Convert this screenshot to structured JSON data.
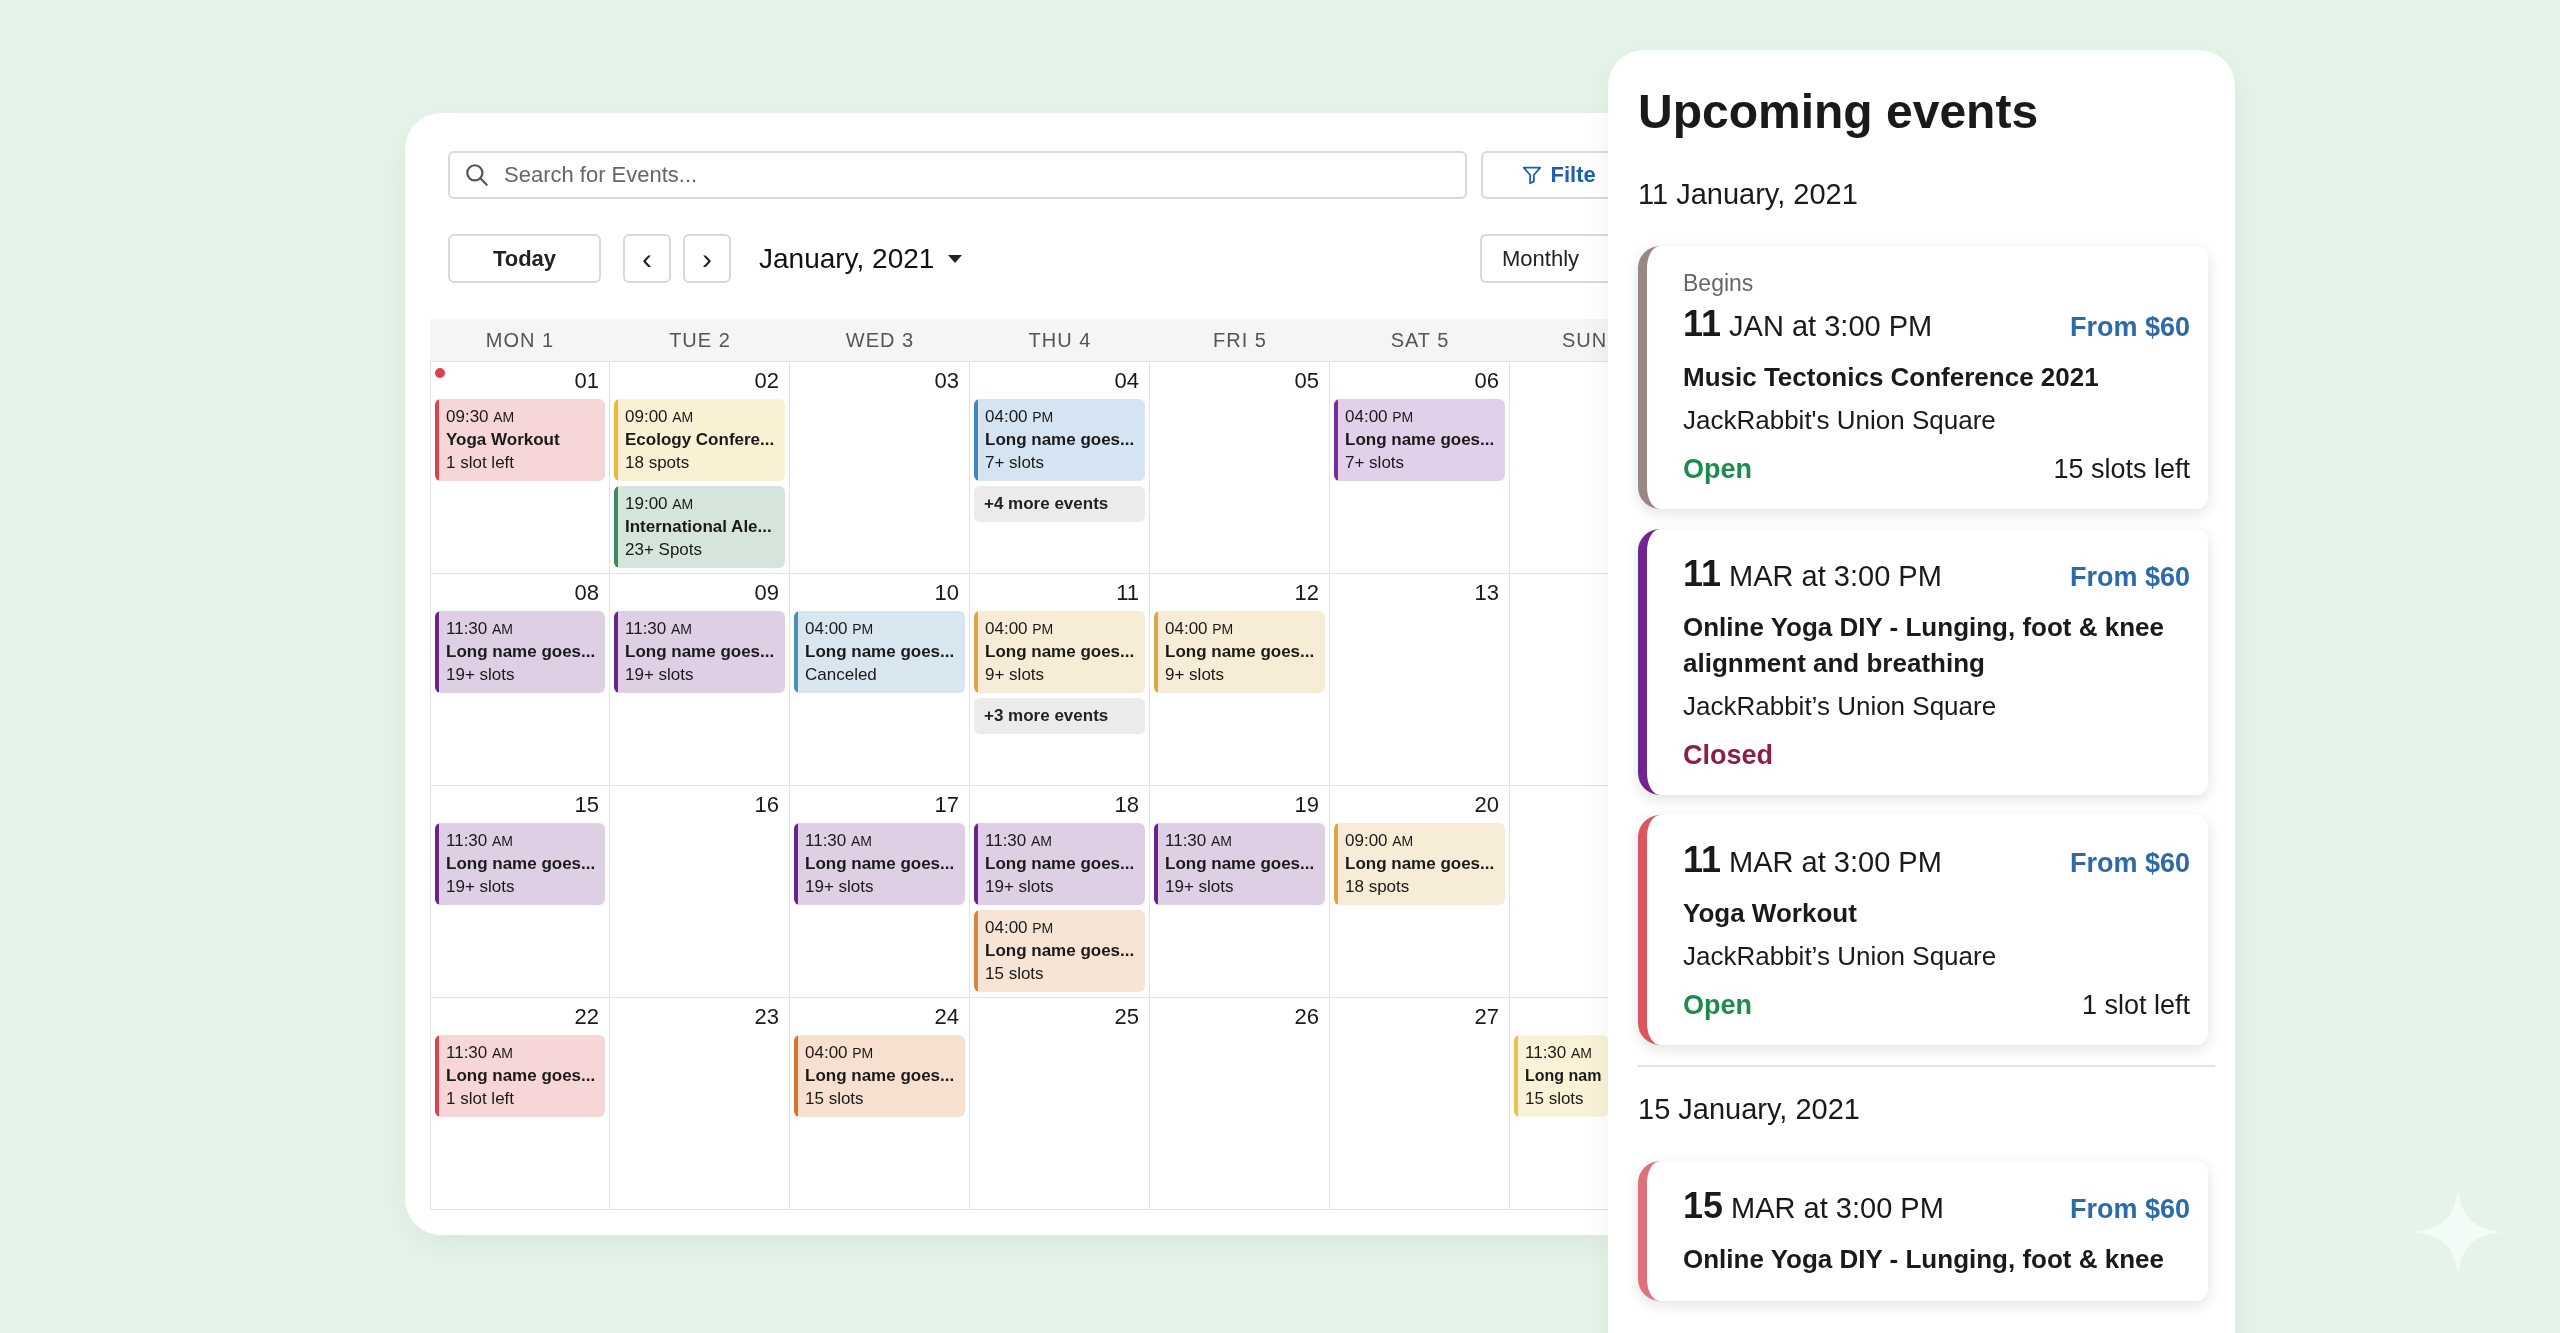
{
  "calendar": {
    "search": {
      "placeholder": "Search for Events..."
    },
    "filter_button": "Filte",
    "today_button": "Today",
    "prev_button": "‹",
    "next_button": "›",
    "month": "January, 2021",
    "view_select": "Monthly",
    "weekdays": [
      "MON 1",
      "TUE 2",
      "WED 3",
      "THU 4",
      "FRI 5",
      "SAT 5",
      "SUN"
    ],
    "weeks": [
      {
        "days": [
          {
            "date": "01",
            "today": true,
            "events": [
              {
                "time": "09:30",
                "period": "AM",
                "title": "Yoga Workout",
                "detail": "1 slot left",
                "color": "#d9434f"
              }
            ]
          },
          {
            "date": "02",
            "today": false,
            "events": [
              {
                "time": "09:00",
                "period": "AM",
                "title": "Ecology Confere...",
                "detail": "18 spots",
                "color": "#e8b93a"
              },
              {
                "time": "19:00",
                "period": "AM",
                "title": "International Ale...",
                "detail": "23+ Spots",
                "color": "#3f8a5a"
              }
            ]
          },
          {
            "date": "03",
            "today": false
          },
          {
            "date": "04",
            "today": false,
            "events": [
              {
                "time": "04:00",
                "period": "PM",
                "title": "Long name goes...",
                "detail": "7+ slots",
                "color": "#3f86c4"
              }
            ],
            "more": "+4 more events"
          },
          {
            "date": "05",
            "today": false
          },
          {
            "date": "06",
            "today": false,
            "events": [
              {
                "time": "04:00",
                "period": "PM",
                "title": "Long name goes...",
                "detail": "7+ slots",
                "color": "#7b2a9e"
              }
            ]
          },
          {
            "today": false
          }
        ]
      },
      {
        "days": [
          {
            "date": "08",
            "today": false,
            "events": [
              {
                "time": "11:30",
                "period": "AM",
                "title": "Long name goes...",
                "detail": "19+ slots",
                "color": "#6a2488"
              }
            ]
          },
          {
            "date": "09",
            "today": false,
            "events": [
              {
                "time": "11:30",
                "period": "AM",
                "title": "Long name goes...",
                "detail": "19+ slots",
                "color": "#6a2488"
              }
            ]
          },
          {
            "date": "10",
            "today": false,
            "events": [
              {
                "time": "04:00",
                "period": "PM",
                "title": "Long name goes...",
                "detail": "Canceled",
                "color": "#4a8fb8"
              }
            ]
          },
          {
            "date": "11",
            "today": false,
            "events": [
              {
                "time": "04:00",
                "period": "PM",
                "title": "Long name goes...",
                "detail": "9+ slots",
                "color": "#d9a840"
              }
            ],
            "more": "+3 more events"
          },
          {
            "date": "12",
            "today": false,
            "events": [
              {
                "time": "04:00",
                "period": "PM",
                "title": "Long name goes...",
                "detail": "9+ slots",
                "color": "#d9a840"
              }
            ]
          },
          {
            "date": "13",
            "today": false
          },
          {
            "today": false
          }
        ]
      },
      {
        "days": [
          {
            "date": "15",
            "today": false,
            "events": [
              {
                "time": "11:30",
                "period": "AM",
                "title": "Long name goes...",
                "detail": "19+ slots",
                "color": "#6a2488"
              }
            ]
          },
          {
            "date": "16",
            "today": false
          },
          {
            "date": "17",
            "today": false,
            "events": [
              {
                "time": "11:30",
                "period": "AM",
                "title": "Long name goes...",
                "detail": "19+ slots",
                "color": "#6a2488"
              }
            ]
          },
          {
            "date": "18",
            "today": false,
            "events": [
              {
                "time": "11:30",
                "period": "AM",
                "title": "Long name goes...",
                "detail": "19+ slots",
                "color": "#6a2488"
              },
              {
                "time": "04:00",
                "period": "PM",
                "title": "Long name goes...",
                "detail": "15 slots",
                "color": "#d9843a"
              }
            ]
          },
          {
            "date": "19",
            "today": false,
            "events": [
              {
                "time": "11:30",
                "period": "AM",
                "title": "Long name goes...",
                "detail": "19+ slots",
                "color": "#6a2488"
              }
            ]
          },
          {
            "date": "20",
            "today": false,
            "events": [
              {
                "time": "09:00",
                "period": "AM",
                "title": "Long name goes...",
                "detail": "18 spots",
                "color": "#d9a840"
              }
            ]
          },
          {
            "today": false
          }
        ]
      },
      {
        "days": [
          {
            "date": "22",
            "today": false,
            "events": [
              {
                "time": "11:30",
                "period": "AM",
                "title": "Long name goes...",
                "detail": "1 slot left",
                "color": "#d9434f"
              }
            ]
          },
          {
            "date": "23",
            "today": false
          },
          {
            "date": "24",
            "today": false,
            "events": [
              {
                "time": "04:00",
                "period": "PM",
                "title": "Long name goes...",
                "detail": "15 slots",
                "color": "#d9742a"
              }
            ]
          },
          {
            "date": "25",
            "today": false
          },
          {
            "date": "26",
            "today": false
          },
          {
            "date": "27",
            "today": false
          },
          {
            "today": false,
            "events": [
              {
                "time": "11:30",
                "period": "AM",
                "title": "Long nam",
                "detail": "15 slots",
                "color": "#e8c24a"
              }
            ]
          }
        ]
      }
    ]
  },
  "upcoming": {
    "title": "Upcoming events",
    "groups": [
      {
        "date": "11 January, 2021",
        "events": [
          {
            "begins": "Begins",
            "day": "11",
            "when": "JAN at 3:00 PM",
            "price": "From $60",
            "title": "Music Tectonics Conference 2021",
            "venue": "JackRabbit's Union Square",
            "status": "Open",
            "kind": "open",
            "slots": "15 slots left",
            "color": "#9a8683"
          },
          {
            "day": "11",
            "when": "MAR at 3:00 PM",
            "price": "From $60",
            "title": "Online Yoga DIY - Lunging, foot & knee alignment and breathing",
            "venue": "JackRabbit’s Union Square",
            "status": "Closed",
            "kind": "closed",
            "color": "#6e2590"
          },
          {
            "day": "11",
            "when": "MAR at 3:00 PM",
            "price": "From $60",
            "title": "Yoga Workout",
            "venue": "JackRabbit’s Union Square",
            "status": "Open",
            "kind": "open",
            "slots": "1 slot left",
            "color": "#d9575e"
          }
        ]
      },
      {
        "date": "15 January, 2021",
        "events": [
          {
            "day": "15",
            "when": "MAR at 3:00 PM",
            "price": "From $60",
            "title": "Online Yoga DIY - Lunging, foot & knee",
            "color": "#e0707a"
          }
        ]
      }
    ]
  }
}
